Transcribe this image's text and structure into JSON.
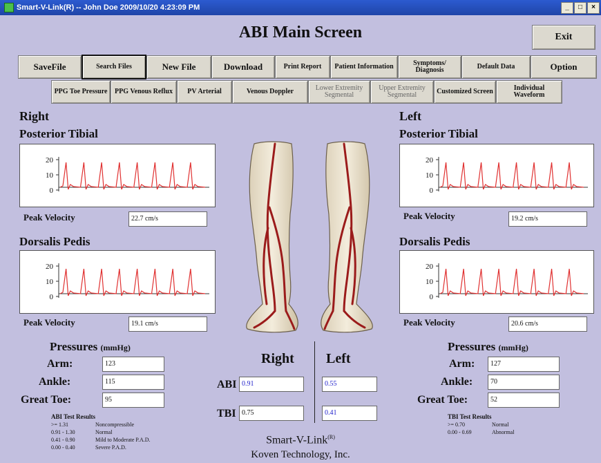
{
  "window": {
    "title": "Smart-V-Link(R) -- John Doe  2009/10/20  4:23:09 PM",
    "min": "_",
    "max": "□",
    "close": "×"
  },
  "screen_title": "ABI Main Screen",
  "exit_label": "Exit",
  "toolbar1": [
    {
      "label": "SaveFile"
    },
    {
      "label": "Search Files"
    },
    {
      "label": "New File"
    },
    {
      "label": "Download"
    },
    {
      "label": "Print Report"
    },
    {
      "label": "Patient Information"
    },
    {
      "label": "Symptoms/ Diagnosis"
    },
    {
      "label": "Default Data"
    },
    {
      "label": "Option"
    }
  ],
  "toolbar2": [
    {
      "label": "PPG Toe Pressure"
    },
    {
      "label": "PPG Venous Reflux"
    },
    {
      "label": "PV Arterial"
    },
    {
      "label": "Venous Doppler"
    },
    {
      "label": "Lower Extremity Segmental"
    },
    {
      "label": "Upper Extremity Segmental"
    },
    {
      "label": "Customized Screen"
    },
    {
      "label": "Individual Waveform"
    }
  ],
  "right": {
    "side": "Right",
    "posterior_tibial": {
      "title": "Posterior Tibial",
      "peak_label": "Peak Velocity",
      "peak_value": "22.7 cm/s"
    },
    "dorsalis_pedis": {
      "title": "Dorsalis Pedis",
      "peak_label": "Peak Velocity",
      "peak_value": "19.1 cm/s"
    },
    "pressures": {
      "title": "Pressures",
      "unit": "(mmHg)",
      "arm_label": "Arm:",
      "arm": "123",
      "ankle_label": "Ankle:",
      "ankle": "115",
      "toe_label": "Great Toe:",
      "toe": "95"
    }
  },
  "left": {
    "side": "Left",
    "posterior_tibial": {
      "title": "Posterior Tibial",
      "peak_label": "Peak Velocity",
      "peak_value": "19.2 cm/s"
    },
    "dorsalis_pedis": {
      "title": "Dorsalis Pedis",
      "peak_label": "Peak Velocity",
      "peak_value": "20.6 cm/s"
    },
    "pressures": {
      "title": "Pressures",
      "unit": "(mmHg)",
      "arm_label": "Arm:",
      "arm": "127",
      "ankle_label": "Ankle:",
      "ankle": "70",
      "toe_label": "Great Toe:",
      "toe": "52"
    }
  },
  "wave_ticks": [
    "20",
    "10",
    "0"
  ],
  "center": {
    "right_label": "Right",
    "left_label": "Left",
    "abi_label": "ABI",
    "tbi_label": "TBI",
    "abi_right": "0.91",
    "abi_left": "0.55",
    "tbi_right": "0.75",
    "tbi_left": "0.41"
  },
  "abi_results": {
    "title": "ABI Test Results",
    "rows": [
      {
        "range": ">= 1.31",
        "meaning": "Noncompressible"
      },
      {
        "range": "0.91 - 1.30",
        "meaning": "Normal"
      },
      {
        "range": "0.41 - 0.90",
        "meaning": "Mild to Moderate P.A.D."
      },
      {
        "range": "0.00 - 0.40",
        "meaning": "Severe P.A.D."
      }
    ]
  },
  "tbi_results": {
    "title": "TBI Test Results",
    "rows": [
      {
        "range": ">= 0.70",
        "meaning": "Normal"
      },
      {
        "range": "0.00 - 0.69",
        "meaning": "Abnormal"
      }
    ]
  },
  "brand": {
    "name": "Smart-V-Link",
    "mark": "(R)",
    "company": "Koven Technology, Inc."
  },
  "colors": {
    "background": "#c2bfdf",
    "wave": "#e03030",
    "titlebar": "#2c5bd0",
    "legs_artery": "#9b1b1b"
  }
}
